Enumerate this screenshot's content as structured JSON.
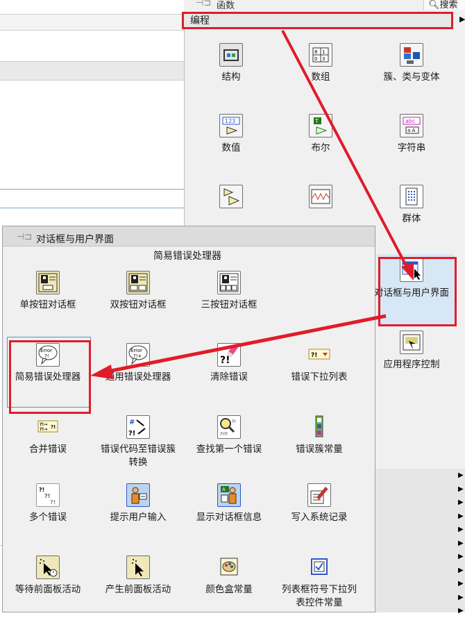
{
  "palette": {
    "title": "函数",
    "search_label": "搜索",
    "category": "编程",
    "items": [
      {
        "label": "结构",
        "icon": "structures-icon"
      },
      {
        "label": "数组",
        "icon": "array-icon"
      },
      {
        "label": "簇、类与变体",
        "icon": "cluster-icon"
      },
      {
        "label": "数值",
        "icon": "numeric-icon"
      },
      {
        "label": "布尔",
        "icon": "boolean-icon"
      },
      {
        "label": "字符串",
        "icon": "string-icon"
      },
      {
        "label": "群体",
        "icon": "synchronization-icon"
      },
      {
        "label": "对话框与用户界面",
        "icon": "dialog-ui-icon"
      },
      {
        "label": "应用程序控制",
        "icon": "app-control-icon"
      }
    ]
  },
  "dialog_palette": {
    "title": "对话框与用户界面",
    "hover_label": "简易错误处理器",
    "items": [
      {
        "label": "单按钮对话框",
        "icon": "one-button-dialog-icon"
      },
      {
        "label": "双按钮对话框",
        "icon": "two-button-dialog-icon"
      },
      {
        "label": "三按钮对话框",
        "icon": "three-button-dialog-icon"
      },
      {
        "label": "简易错误处理器",
        "icon": "simple-error-handler-icon"
      },
      {
        "label": "通用错误处理器",
        "icon": "general-error-handler-icon"
      },
      {
        "label": "清除错误",
        "icon": "clear-errors-icon"
      },
      {
        "label": "错误下拉列表",
        "icon": "error-ring-icon"
      },
      {
        "label": "合并错误",
        "icon": "merge-errors-icon"
      },
      {
        "label": "错误代码至错误簇转换",
        "icon": "error-code-to-cluster-icon"
      },
      {
        "label": "查找第一个错误",
        "icon": "find-first-error-icon"
      },
      {
        "label": "错误簇常量",
        "icon": "error-cluster-constant-icon"
      },
      {
        "label": "多个错误",
        "icon": "multiple-errors-icon"
      },
      {
        "label": "提示用户输入",
        "icon": "prompt-user-icon"
      },
      {
        "label": "显示对话框信息",
        "icon": "display-dialog-icon"
      },
      {
        "label": "写入系统记录",
        "icon": "write-syslog-icon"
      },
      {
        "label": "等待前面板活动",
        "icon": "wait-fp-activity-icon"
      },
      {
        "label": "产生前面板活动",
        "icon": "generate-fp-activity-icon"
      },
      {
        "label": "颜色盒常量",
        "icon": "color-box-icon"
      },
      {
        "label": "列表框符号下拉列表控件常量",
        "icon": "listbox-symbol-icon"
      }
    ]
  },
  "colors": {
    "highlight": "#e01c2a",
    "select": "#4f95d6"
  }
}
